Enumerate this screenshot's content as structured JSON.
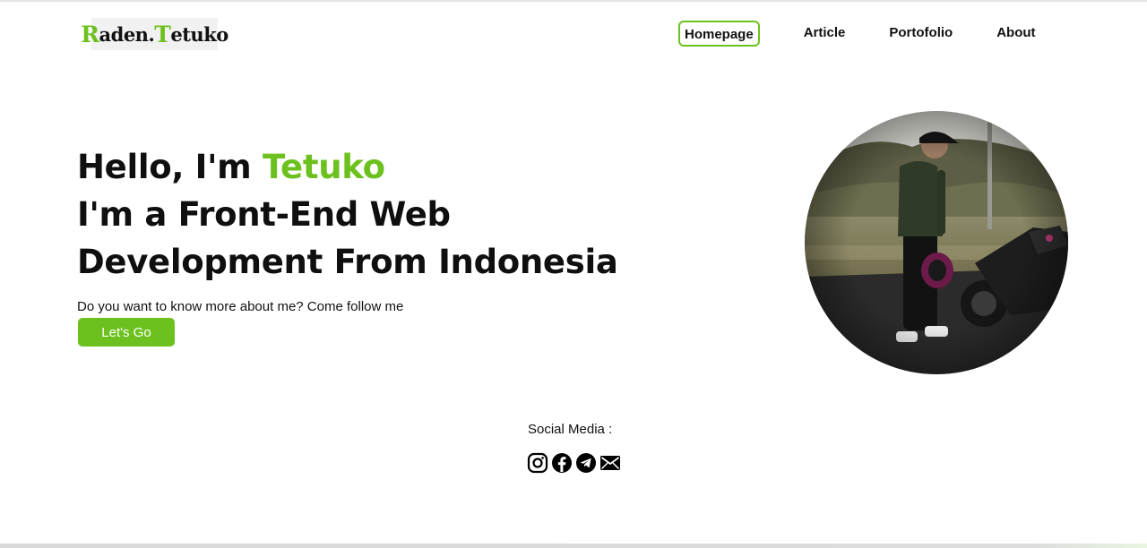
{
  "brand": {
    "logo_initial": "R",
    "logo_mid": "aden.",
    "logo_initial2": "T",
    "logo_rest": "etuko"
  },
  "nav": {
    "items": [
      {
        "label": "Homepage",
        "active": true
      },
      {
        "label": "Article",
        "active": false
      },
      {
        "label": "Portofolio",
        "active": false
      },
      {
        "label": "About",
        "active": false
      }
    ]
  },
  "hero": {
    "greeting": "Hello, I'm ",
    "name": "Tetuko",
    "line2": "I'm a Front-End Web",
    "line3": "Development From Indonesia",
    "subtitle": "Do you want to know more about me? Come follow me",
    "cta_label": "Let's Go"
  },
  "social": {
    "title": "Social Media :",
    "icons": [
      "instagram-icon",
      "facebook-icon",
      "telegram-icon",
      "email-icon"
    ]
  },
  "colors": {
    "accent": "#6cc11f",
    "text": "#111111",
    "background": "#ffffff"
  }
}
